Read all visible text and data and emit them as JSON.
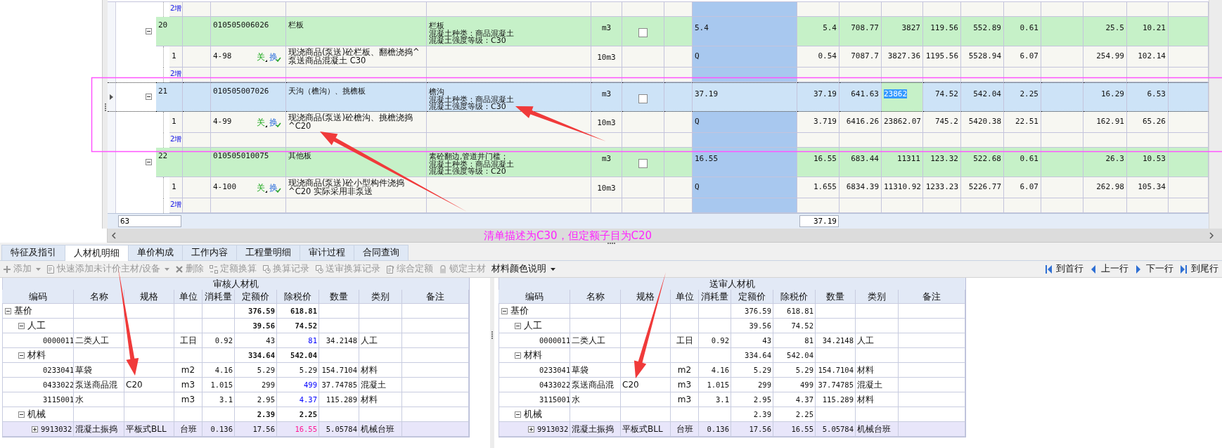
{
  "top_grid": {
    "rows": [
      {
        "kind": "add",
        "label": "2增"
      },
      {
        "kind": "item",
        "seq": "20",
        "code": "010505006026",
        "name": "栏板",
        "features": [
          "栏板",
          "混凝土种类：商品混凝土",
          "混凝土强度等级：C30"
        ],
        "unit": "m3",
        "checked": false,
        "expression": "5.4",
        "expanded": true,
        "selected": false,
        "current": false,
        "values": [
          {
            "text": "5.4",
            "selected": false
          },
          {
            "text": "708.77",
            "selected": false
          },
          {
            "text": "3827",
            "selected": false
          },
          {
            "text": "119.56",
            "selected": false
          },
          {
            "text": "552.89",
            "selected": false
          },
          {
            "text": "0.61",
            "selected": false
          },
          {
            "text": "25.5",
            "selected": false
          },
          {
            "text": "10.21",
            "selected": false
          }
        ]
      },
      {
        "kind": "quota",
        "seq": "1",
        "code": "4-98",
        "tags": [
          {
            "text": "关",
            "kind": "relation"
          },
          {
            "text": "换",
            "kind": "conversion"
          }
        ],
        "name": [
          "现浇商品(泵送)砼栏板、翻檐浇捣^",
          "泵送商品混凝土 C30"
        ],
        "unit": "10m3",
        "expression": "Q",
        "values": [
          "0.54",
          "7087.7",
          "3827.36",
          "1195.56",
          "5528.94",
          "6.07",
          "254.99",
          "102.14"
        ]
      },
      {
        "kind": "add",
        "label": "2增"
      },
      {
        "kind": "item",
        "seq": "21",
        "code": "010505007026",
        "name": "天沟（檐沟）、挑檐板",
        "features": [
          "檐沟",
          "混凝土种类：商品混凝土",
          "混凝土强度等级：C30"
        ],
        "unit": "m3",
        "checked": false,
        "expression": "37.19",
        "expanded": true,
        "selected": true,
        "current": true,
        "values": [
          {
            "text": "37.19",
            "selected": false
          },
          {
            "text": "641.63",
            "selected": false
          },
          {
            "text": "23862",
            "selected": true
          },
          {
            "text": "74.52",
            "selected": false
          },
          {
            "text": "542.04",
            "selected": false
          },
          {
            "text": "2.25",
            "selected": false
          },
          {
            "text": "16.29",
            "selected": false
          },
          {
            "text": "6.53",
            "selected": false
          }
        ]
      },
      {
        "kind": "quota",
        "seq": "1",
        "code": "4-99",
        "tags": [
          {
            "text": "关",
            "kind": "relation"
          },
          {
            "text": "换",
            "kind": "conversion"
          }
        ],
        "name": [
          "现浇商品(泵送)砼檐沟、挑檐浇捣",
          "^C20"
        ],
        "unit": "10m3",
        "expression": "Q",
        "values": [
          "3.719",
          "6416.26",
          "23862.07",
          "745.2",
          "5420.38",
          "22.51",
          "162.91",
          "65.26"
        ]
      },
      {
        "kind": "add",
        "label": "2增"
      },
      {
        "kind": "item",
        "seq": "22",
        "code": "010505010075",
        "name": "其他板",
        "features": [
          "素砼翻边,管道井门槛；",
          "混凝土种类：商品混凝土",
          "混凝土强度等级：C20"
        ],
        "unit": "m3",
        "checked": false,
        "expression": "16.55",
        "expanded": true,
        "selected": false,
        "current": false,
        "values": [
          {
            "text": "16.55",
            "selected": false
          },
          {
            "text": "683.44",
            "selected": false
          },
          {
            "text": "11311",
            "selected": false
          },
          {
            "text": "123.32",
            "selected": false
          },
          {
            "text": "522.68",
            "selected": false
          },
          {
            "text": "0.61",
            "selected": false
          },
          {
            "text": "26.3",
            "selected": false
          },
          {
            "text": "10.53",
            "selected": false
          }
        ]
      },
      {
        "kind": "quota",
        "seq": "1",
        "code": "4-100",
        "tags": [
          {
            "text": "关",
            "kind": "relation"
          },
          {
            "text": "换",
            "kind": "conversion"
          }
        ],
        "name": [
          "现浇商品(泵送)砼小型构件浇捣",
          "^C20 实际采用非泵送"
        ],
        "unit": "10m3",
        "expression": "Q",
        "values": [
          "1.655",
          "6834.39",
          "11310.92",
          "1233.23",
          "5226.77",
          "6.07",
          "262.98",
          "105.34"
        ]
      },
      {
        "kind": "add",
        "label": "2增"
      }
    ],
    "footer": {
      "count": "63",
      "total": "37.19"
    }
  },
  "note": "清单描述为C30，但定额子目为C20",
  "tabs": [
    {
      "label": "特征及指引",
      "selected": false
    },
    {
      "label": "人材机明细",
      "selected": true
    },
    {
      "label": "单价构成",
      "selected": false
    },
    {
      "label": "工作内容",
      "selected": false
    },
    {
      "label": "工程量明细",
      "selected": false
    },
    {
      "label": "审计过程",
      "selected": false
    },
    {
      "label": "合同查询",
      "selected": false
    }
  ],
  "toolbar": {
    "items": [
      {
        "label": "添加",
        "dropdown": true,
        "disabled": true
      },
      {
        "label": "快速添加未计价主材/设备",
        "dropdown": true,
        "disabled": true
      },
      {
        "label": "删除",
        "dropdown": false,
        "disabled": true
      },
      {
        "label": "定额换算",
        "dropdown": false,
        "disabled": true
      },
      {
        "label": "换算记录",
        "dropdown": false,
        "disabled": true
      },
      {
        "label": "送审换算记录",
        "dropdown": false,
        "disabled": true
      },
      {
        "label": "综合定额",
        "dropdown": false,
        "disabled": true
      },
      {
        "label": "锁定主材",
        "dropdown": false,
        "disabled": true
      },
      {
        "label": "材料颜色说明",
        "dropdown": true,
        "disabled": false
      }
    ],
    "nav": [
      {
        "label": "到首行"
      },
      {
        "label": "上一行"
      },
      {
        "label": "下一行"
      },
      {
        "label": "到尾行"
      }
    ]
  },
  "tables": [
    {
      "title": "审核人材机",
      "bold_totals": true,
      "columns": [
        "编码",
        "名称",
        "规格",
        "单位",
        "消耗量",
        "定额价",
        "除税价",
        "数量",
        "类别",
        "备注"
      ],
      "rows": [
        {
          "code": "基价",
          "expanded": true,
          "price": "376.59",
          "tax_price": "618.81",
          "selected": false,
          "children": [
            {
              "code": "人工",
              "expanded": true,
              "price": "39.56",
              "tax_price": "74.52",
              "selected": false,
              "children": [
                {
                  "code": "0000011",
                  "name": "二类人工",
                  "unit": "工日",
                  "qty": "0.92",
                  "price": "43",
                  "tax_price": "81",
                  "color": "#0000ff",
                  "amount": "34.2148",
                  "category": "人工",
                  "selected": false
                }
              ]
            },
            {
              "code": "材料",
              "expanded": true,
              "price": "334.64",
              "tax_price": "542.04",
              "selected": false,
              "children": [
                {
                  "code": "0233041",
                  "name": "草袋",
                  "unit": "m2",
                  "qty": "4.16",
                  "price": "5.29",
                  "tax_price": "5.29",
                  "amount": "154.7104",
                  "category": "材料",
                  "selected": false
                },
                {
                  "code": "0433022",
                  "name": "泵送商品混",
                  "spec": "C20",
                  "unit": "m3",
                  "qty": "1.015",
                  "price": "299",
                  "tax_price": "499",
                  "color": "#0000ff",
                  "amount": "37.74785",
                  "category": "混凝土",
                  "selected": false
                },
                {
                  "code": "3115001",
                  "name": "水",
                  "unit": "m3",
                  "qty": "3.1",
                  "price": "2.95",
                  "tax_price": "4.37",
                  "color": "#0000ff",
                  "amount": "115.289",
                  "category": "材料",
                  "selected": false
                }
              ]
            },
            {
              "code": "机械",
              "expanded": true,
              "price": "2.39",
              "tax_price": "2.25",
              "selected": false,
              "children": [
                {
                  "code": "9913032",
                  "name": "混凝土振捣",
                  "spec": "平板式BLL",
                  "unit": "台班",
                  "qty": "0.136",
                  "price": "17.56",
                  "tax_price": "16.55",
                  "color": "#ff1493",
                  "amount": "5.05784",
                  "category": "机械台班",
                  "expanded": false,
                  "selected": true
                }
              ]
            }
          ]
        }
      ]
    },
    {
      "title": "送审人材机",
      "bold_totals": false,
      "columns": [
        "编码",
        "名称",
        "规格",
        "单位",
        "消耗量",
        "定额价",
        "除税价",
        "数量",
        "类别",
        "备注"
      ],
      "rows": [
        {
          "code": "基价",
          "expanded": true,
          "price": "376.59",
          "tax_price": "618.81",
          "selected": false,
          "children": [
            {
              "code": "人工",
              "expanded": true,
              "price": "39.56",
              "tax_price": "74.52",
              "selected": false,
              "children": [
                {
                  "code": "0000011",
                  "name": "二类人工",
                  "unit": "工日",
                  "qty": "0.92",
                  "price": "43",
                  "tax_price": "81",
                  "amount": "34.2148",
                  "category": "人工",
                  "selected": false
                }
              ]
            },
            {
              "code": "材料",
              "expanded": true,
              "price": "334.64",
              "tax_price": "542.04",
              "selected": false,
              "children": [
                {
                  "code": "0233041",
                  "name": "草袋",
                  "unit": "m2",
                  "qty": "4.16",
                  "price": "5.29",
                  "tax_price": "5.29",
                  "amount": "154.7104",
                  "category": "材料",
                  "selected": false
                },
                {
                  "code": "0433022",
                  "name": "泵送商品混",
                  "spec": "C20",
                  "unit": "m3",
                  "qty": "1.015",
                  "price": "299",
                  "tax_price": "499",
                  "amount": "37.74785",
                  "category": "混凝土",
                  "selected": false
                },
                {
                  "code": "3115001",
                  "name": "水",
                  "unit": "m3",
                  "qty": "3.1",
                  "price": "2.95",
                  "tax_price": "4.37",
                  "amount": "115.289",
                  "category": "材料",
                  "selected": false
                }
              ]
            },
            {
              "code": "机械",
              "expanded": true,
              "price": "2.39",
              "tax_price": "2.25",
              "selected": false,
              "children": [
                {
                  "code": "9913032",
                  "name": "混凝土振捣",
                  "spec": "平板式BLL",
                  "unit": "台班",
                  "qty": "0.136",
                  "price": "17.56",
                  "tax_price": "16.55",
                  "amount": "5.05784",
                  "category": "机械台班",
                  "expanded": false,
                  "selected": true
                }
              ]
            }
          ]
        }
      ]
    }
  ]
}
